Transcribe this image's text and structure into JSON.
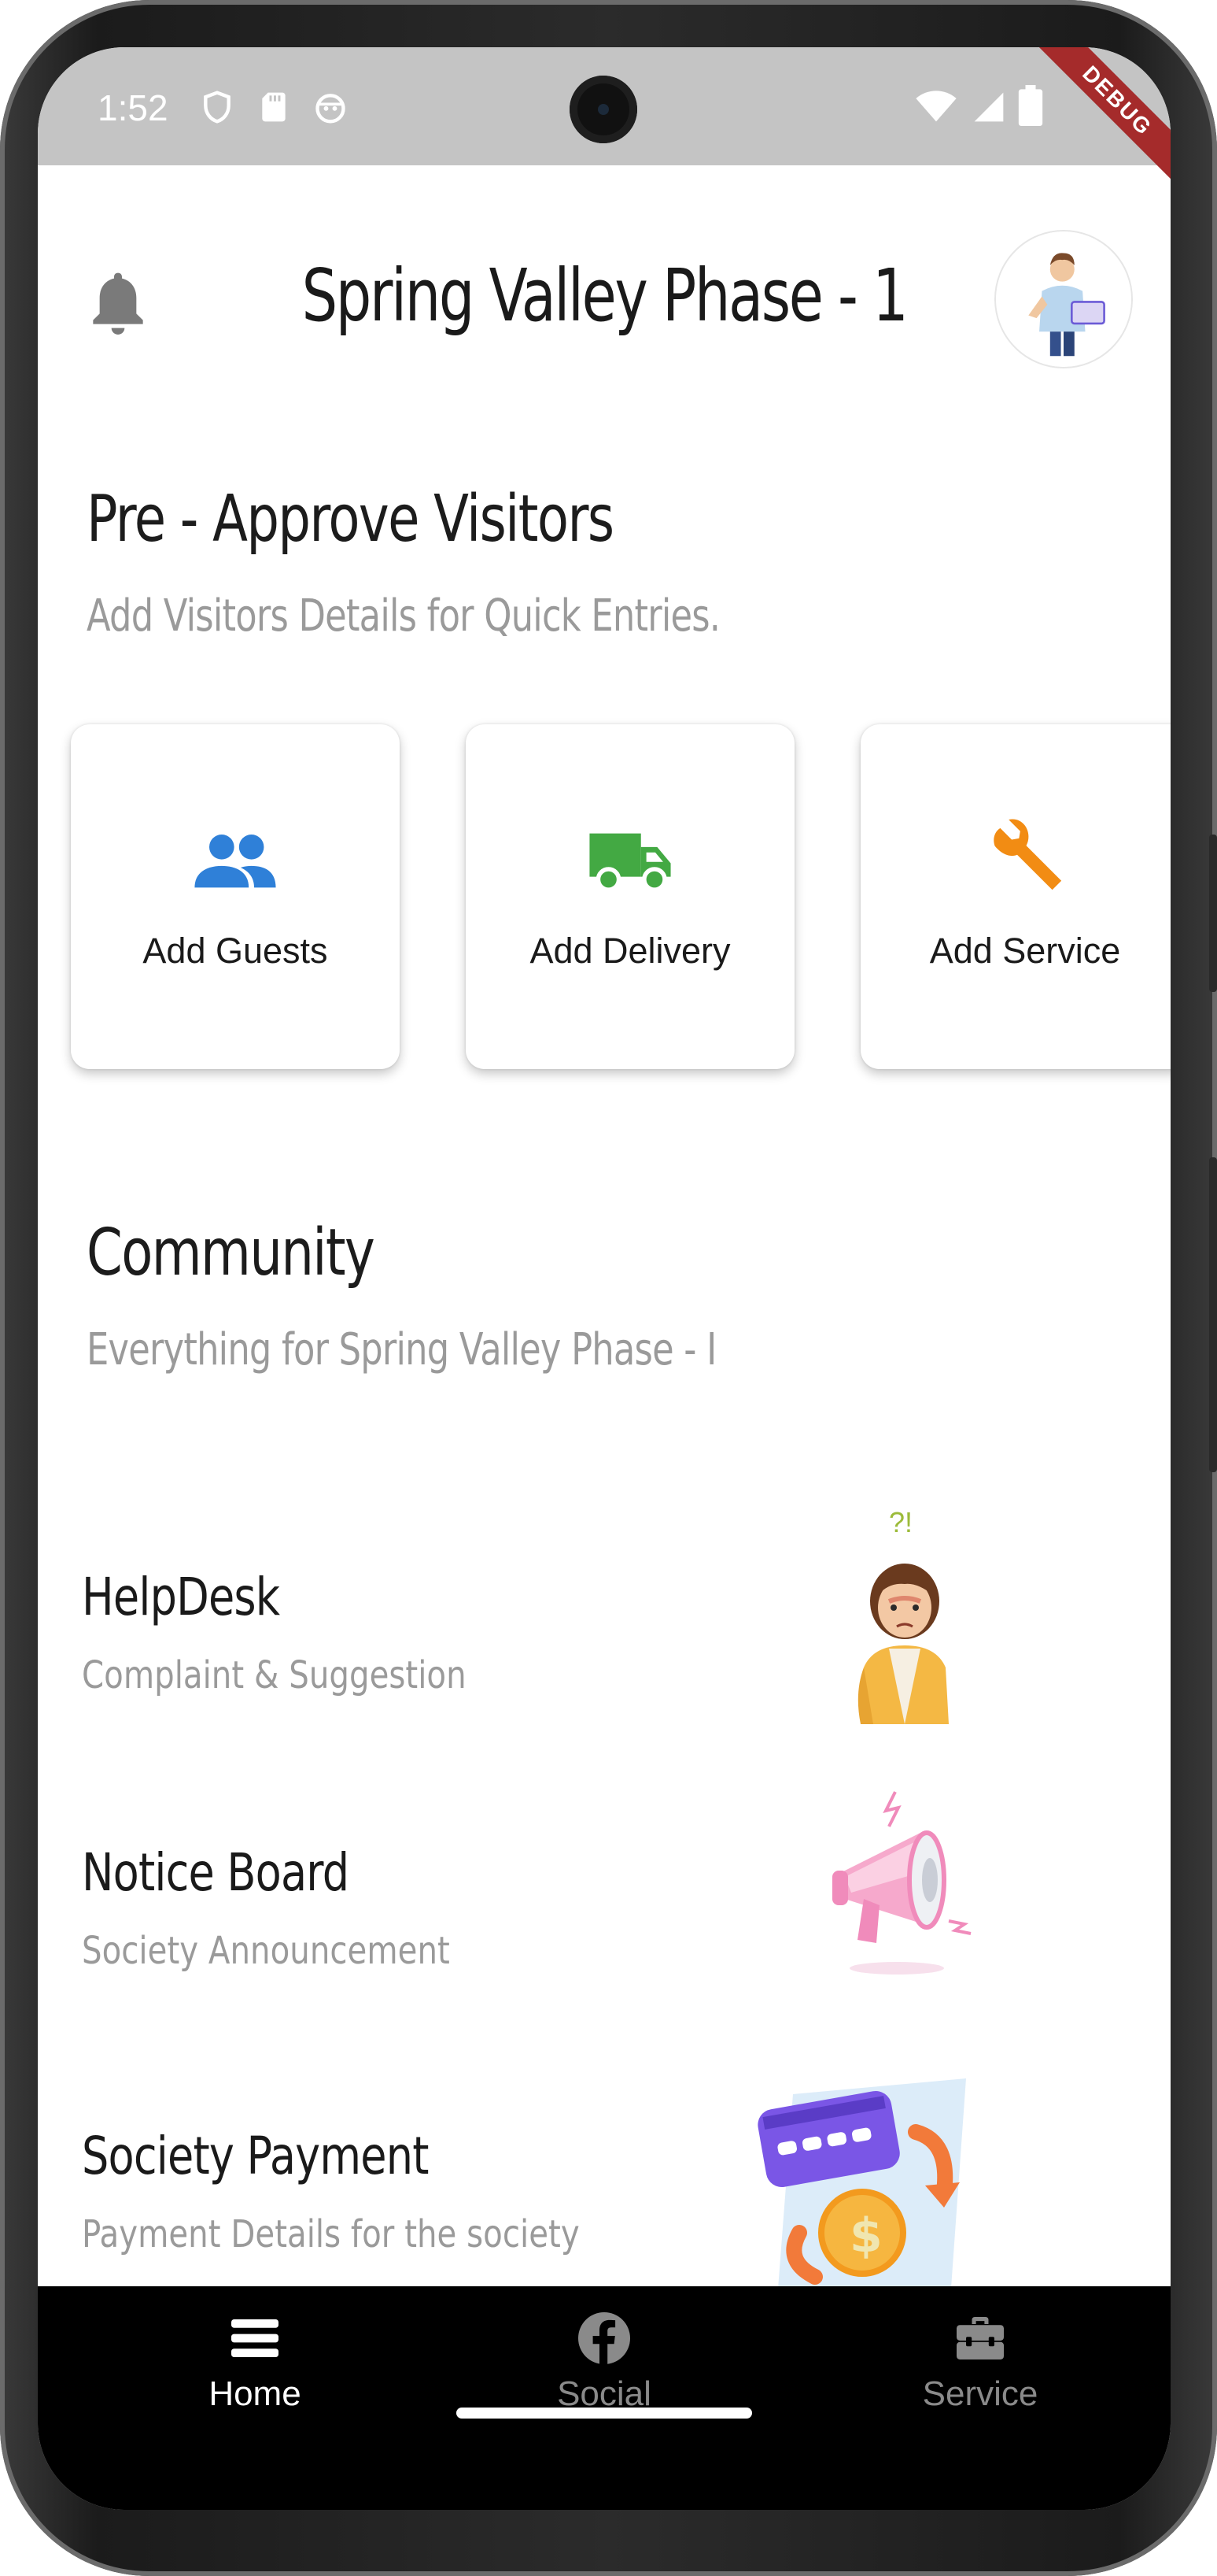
{
  "status_bar": {
    "time": "1:52",
    "icons": [
      "shield-icon",
      "sd-card-icon",
      "android-face-icon",
      "wifi-icon",
      "signal-icon",
      "battery-icon"
    ],
    "debug_label": "DEBUG"
  },
  "header": {
    "title": "Spring Valley Phase - 1",
    "left_icon": "bell-icon",
    "avatar": "user-avatar"
  },
  "pre_approve": {
    "title": "Pre - Approve Visitors",
    "subtitle": "Add Visitors Details for Quick Entries.",
    "cards": [
      {
        "label": "Add Guests",
        "icon": "guests-icon",
        "color": "#2f80d8"
      },
      {
        "label": "Add Delivery",
        "icon": "delivery-truck-icon",
        "color": "#43a943"
      },
      {
        "label": "Add Service",
        "icon": "wrench-icon",
        "color": "#f28c13"
      }
    ]
  },
  "community": {
    "title": "Community",
    "subtitle": "Everything for Spring Valley Phase - I",
    "items": [
      {
        "title": "HelpDesk",
        "subtitle": "Complaint & Suggestion",
        "illustration": "confused-person-illustration"
      },
      {
        "title": "Notice Board",
        "subtitle": "Society Announcement",
        "illustration": "megaphone-illustration"
      },
      {
        "title": "Society Payment",
        "subtitle": "Payment Details for the society",
        "illustration": "card-payment-illustration"
      }
    ]
  },
  "bottom_nav": {
    "items": [
      {
        "label": "Home",
        "icon": "home-menu-icon",
        "active": true
      },
      {
        "label": "Social",
        "icon": "facebook-icon",
        "active": false
      },
      {
        "label": "Service",
        "icon": "toolbox-icon",
        "active": false
      }
    ],
    "active_color": "#ffffff",
    "inactive_color": "#8a8a8a"
  }
}
